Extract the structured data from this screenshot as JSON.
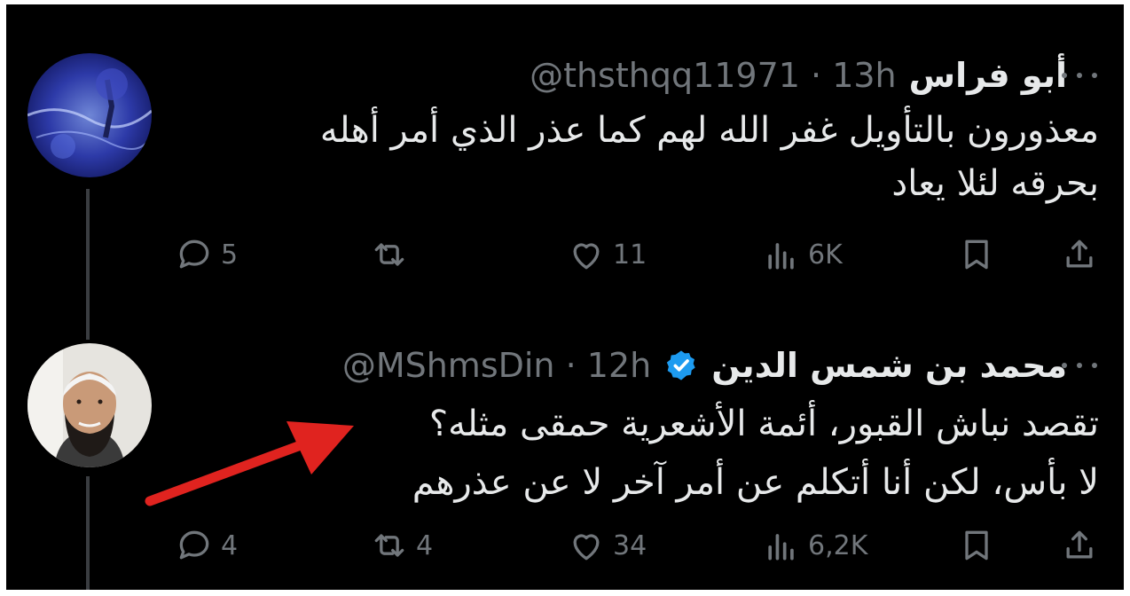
{
  "tweets": [
    {
      "display_name": "أبو فراس",
      "verified": false,
      "handle": "@thsthqq11971",
      "time": "· 13h",
      "body_lines": [
        "معذورون بالتأويل غفر الله لهم كما عذر الذي أمر أهله",
        "بحرقه لئلا يعاد"
      ],
      "metrics": {
        "replies": "5",
        "reposts": "",
        "likes": "11",
        "views": "6K"
      }
    },
    {
      "display_name": "محمد بن شمس الدين",
      "verified": true,
      "handle": "@MShmsDin",
      "time": "· 12h",
      "body_lines": [
        "تقصد نباش القبور، أئمة الأشعرية حمقى مثله؟",
        "لا بأس، لكن أنا أتكلم عن أمر آخر لا عن عذرهم"
      ],
      "metrics": {
        "replies": "4",
        "reposts": "4",
        "likes": "34",
        "views": "6,2K"
      }
    }
  ],
  "icons": {
    "reply": "reply-icon",
    "repost": "repost-icon",
    "like": "heart-icon",
    "views": "views-icon",
    "bookmark": "bookmark-icon",
    "share": "share-icon",
    "more": "more-icon",
    "verified": "verified-badge-icon"
  },
  "colors": {
    "background": "#000000",
    "text": "#e7e9ea",
    "muted": "#71767b",
    "verified": "#1d9bf0",
    "annotation_arrow": "#e0231f"
  }
}
